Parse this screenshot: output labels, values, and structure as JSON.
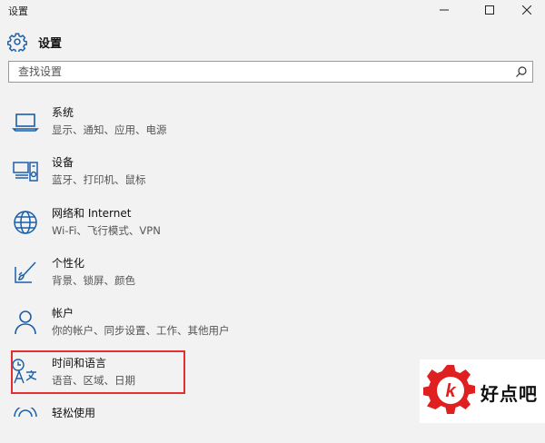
{
  "window": {
    "title": "设置"
  },
  "header": {
    "title": "设置"
  },
  "search": {
    "placeholder": "查找设置"
  },
  "categories": [
    {
      "name": "系统",
      "description": "显示、通知、应用、电源",
      "icon": "laptop-icon"
    },
    {
      "name": "设备",
      "description": "蓝牙、打印机、鼠标",
      "icon": "devices-icon"
    },
    {
      "name": "网络和 Internet",
      "description": "Wi-Fi、飞行模式、VPN",
      "icon": "globe-icon"
    },
    {
      "name": "个性化",
      "description": "背景、锁屏、颜色",
      "icon": "paintbrush-icon"
    },
    {
      "name": "帐户",
      "description": "你的帐户、同步设置、工作、其他用户",
      "icon": "person-icon"
    },
    {
      "name": "时间和语言",
      "description": "语音、区域、日期",
      "icon": "time-language-icon"
    },
    {
      "name": "轻松使用",
      "description": "",
      "icon": "ease-of-access-icon"
    }
  ],
  "watermark": {
    "brand": "好点吧"
  },
  "colors": {
    "accent": "#1a5fa8",
    "highlight": "#e03030",
    "logo": "#e02020"
  }
}
